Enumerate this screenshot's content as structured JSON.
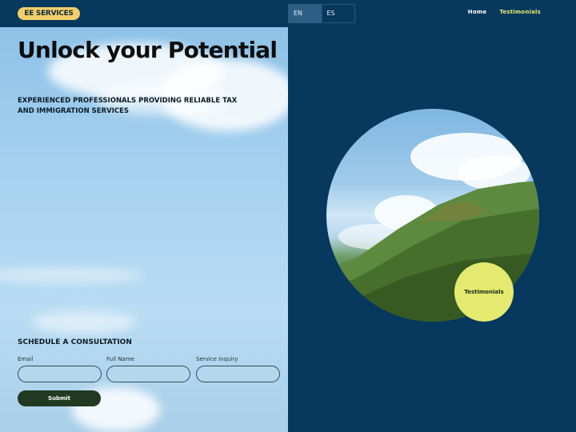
{
  "header": {
    "logo": "EE SERVICES",
    "languages": [
      {
        "code": "EN",
        "active": true
      },
      {
        "code": "ES",
        "active": false
      }
    ],
    "nav": [
      "Home",
      "Testimonials"
    ]
  },
  "hero": {
    "title": "Unlock your Potential",
    "subtitle": "EXPERIENCED PROFESSIONALS PROVIDING RELIABLE TAX AND IMMIGRATION SERVICES"
  },
  "form": {
    "title": "SCHEDULE A CONSULTATION",
    "fields": [
      {
        "label": "Email",
        "value": ""
      },
      {
        "label": "Full Name",
        "value": ""
      },
      {
        "label": "Service Inquiry",
        "value": ""
      }
    ],
    "submit_label": "Submit"
  },
  "badge": {
    "label": "Testimonials"
  },
  "colors": {
    "background": "#07385e",
    "logo_bg": "#f2cf6a",
    "accent": "#e5eb74",
    "submit_bg": "#213920"
  }
}
